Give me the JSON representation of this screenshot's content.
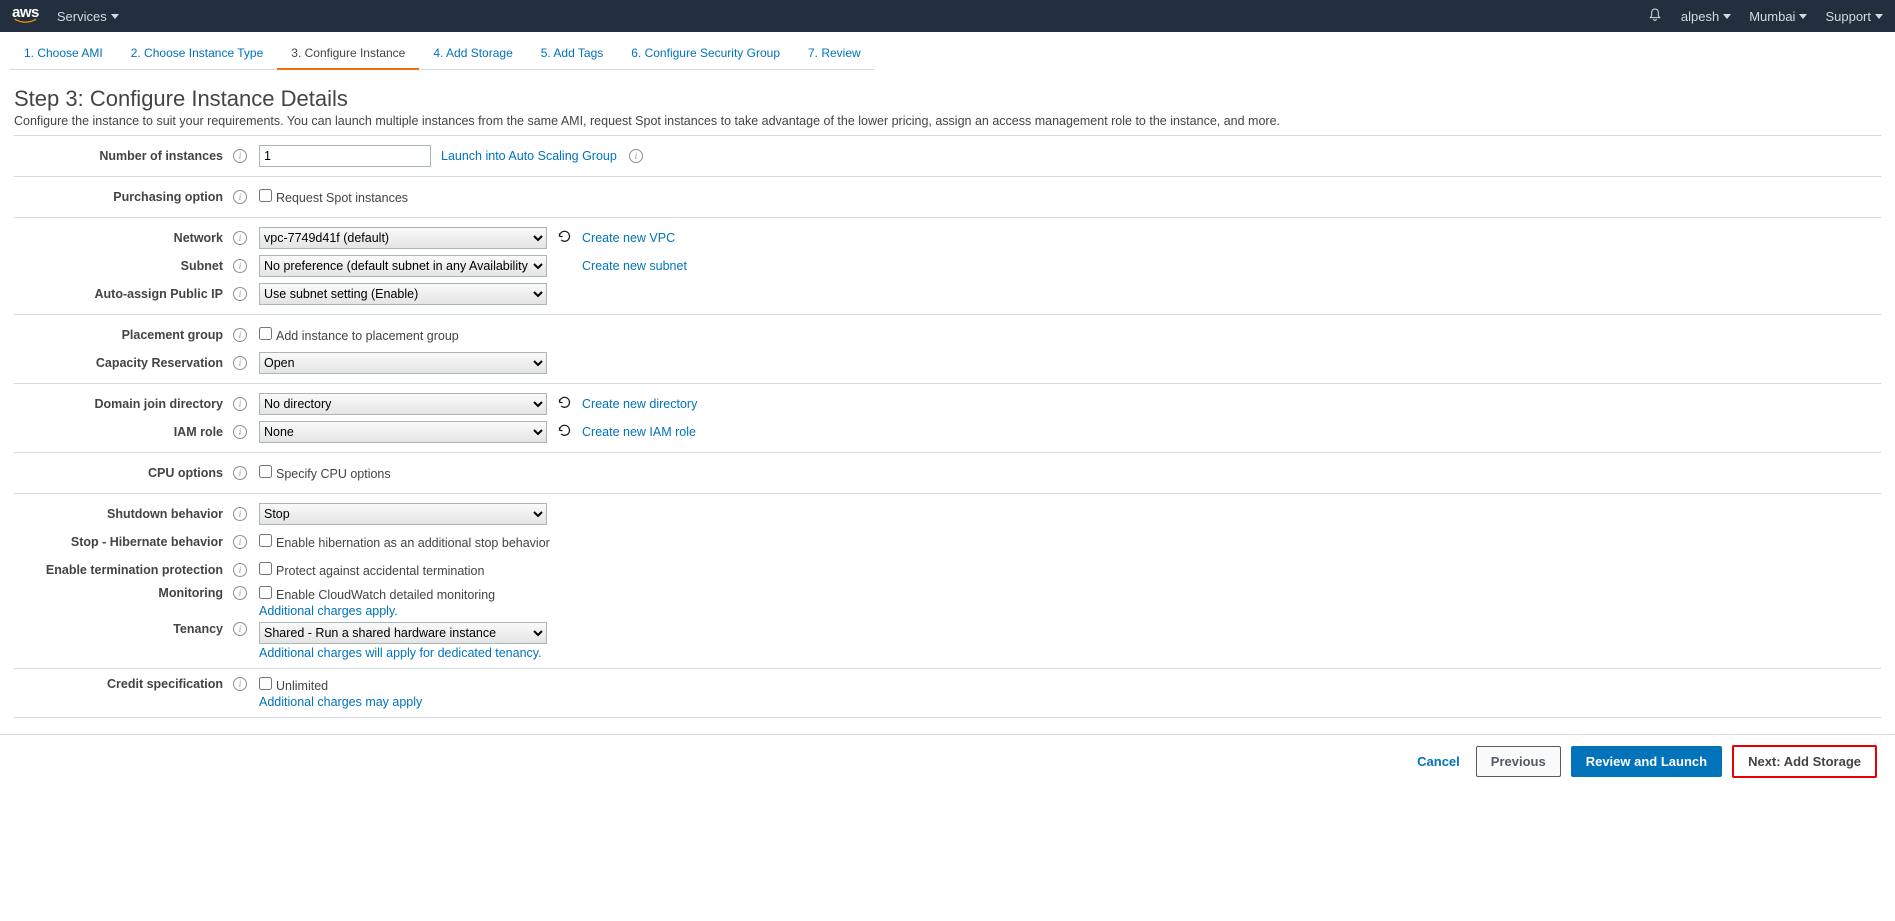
{
  "nav": {
    "logo_text": "aws",
    "services": "Services",
    "user": "alpesh",
    "region": "Mumbai",
    "support": "Support"
  },
  "wizard": {
    "steps": [
      "1. Choose AMI",
      "2. Choose Instance Type",
      "3. Configure Instance",
      "4. Add Storage",
      "5. Add Tags",
      "6. Configure Security Group",
      "7. Review"
    ]
  },
  "page": {
    "title": "Step 3: Configure Instance Details",
    "description": "Configure the instance to suit your requirements. You can launch multiple instances from the same AMI, request Spot instances to take advantage of the lower pricing, assign an access management role to the instance, and more."
  },
  "form": {
    "num_instances": {
      "label": "Number of instances",
      "value": "1",
      "link": "Launch into Auto Scaling Group"
    },
    "purchasing": {
      "label": "Purchasing option",
      "checkbox": "Request Spot instances"
    },
    "network": {
      "label": "Network",
      "value": "vpc-7749d41f (default)",
      "link": "Create new VPC"
    },
    "subnet": {
      "label": "Subnet",
      "value": "No preference (default subnet in any Availability Zone)",
      "link": "Create new subnet"
    },
    "auto_ip": {
      "label": "Auto-assign Public IP",
      "value": "Use subnet setting (Enable)"
    },
    "placement": {
      "label": "Placement group",
      "checkbox": "Add instance to placement group"
    },
    "capacity": {
      "label": "Capacity Reservation",
      "value": "Open"
    },
    "domain": {
      "label": "Domain join directory",
      "value": "No directory",
      "link": "Create new directory"
    },
    "iam": {
      "label": "IAM role",
      "value": "None",
      "link": "Create new IAM role"
    },
    "cpu": {
      "label": "CPU options",
      "checkbox": "Specify CPU options"
    },
    "shutdown": {
      "label": "Shutdown behavior",
      "value": "Stop"
    },
    "hibernate": {
      "label": "Stop - Hibernate behavior",
      "checkbox": "Enable hibernation as an additional stop behavior"
    },
    "termination": {
      "label": "Enable termination protection",
      "checkbox": "Protect against accidental termination"
    },
    "monitoring": {
      "label": "Monitoring",
      "checkbox": "Enable CloudWatch detailed monitoring",
      "note": "Additional charges apply."
    },
    "tenancy": {
      "label": "Tenancy",
      "value": "Shared - Run a shared hardware instance",
      "note": "Additional charges will apply for dedicated tenancy."
    },
    "credit": {
      "label": "Credit specification",
      "checkbox": "Unlimited",
      "note": "Additional charges may apply"
    }
  },
  "footer": {
    "cancel": "Cancel",
    "previous": "Previous",
    "review": "Review and Launch",
    "next": "Next: Add Storage"
  }
}
